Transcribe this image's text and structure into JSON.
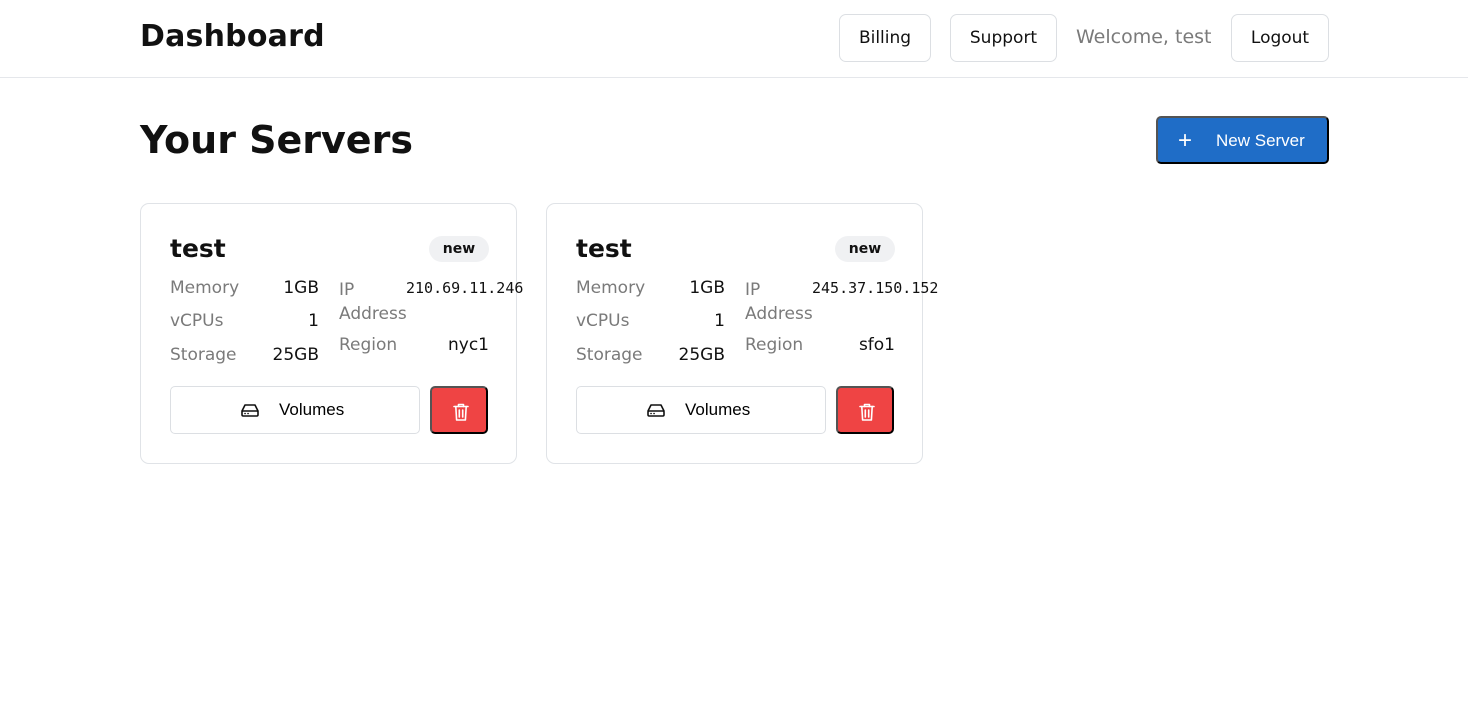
{
  "header": {
    "title": "Dashboard",
    "billing_label": "Billing",
    "support_label": "Support",
    "welcome_text": "Welcome, test",
    "logout_label": "Logout"
  },
  "main": {
    "title": "Your Servers",
    "new_server_label": "New Server",
    "new_server_icon": "plus-icon"
  },
  "labels": {
    "memory": "Memory",
    "vcpus": "vCPUs",
    "storage": "Storage",
    "ip_address": "IP Address",
    "region": "Region",
    "volumes": "Volumes"
  },
  "servers": [
    {
      "name": "test",
      "status": "new",
      "memory": "1GB",
      "vcpus": "1",
      "storage": "25GB",
      "ip": "210.69.11.246",
      "region": "nyc1"
    },
    {
      "name": "test",
      "status": "new",
      "memory": "1GB",
      "vcpus": "1",
      "storage": "25GB",
      "ip": "245.37.150.152",
      "region": "sfo1"
    }
  ],
  "colors": {
    "primary": "#1f6dc7",
    "danger": "#ef4444",
    "muted_text": "#7a7a7a",
    "badge_bg": "#f0f1f3",
    "border": "#e0e3e7"
  },
  "icons": {
    "volumes": "hard-drive-icon",
    "delete": "trash-icon"
  }
}
